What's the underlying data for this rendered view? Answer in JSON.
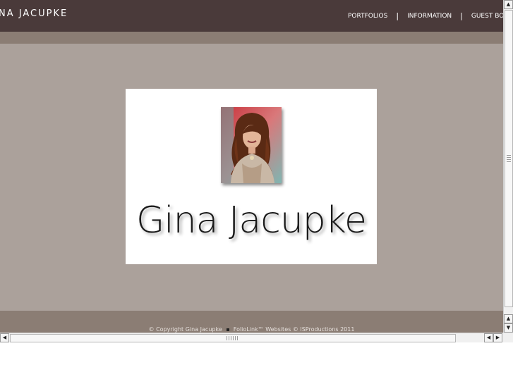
{
  "header": {
    "title": "NA JACUPKE",
    "nav": [
      "PORTFOLIOS",
      "INFORMATION",
      "GUEST BO"
    ],
    "separator": "|"
  },
  "splash": {
    "name": "Gina Jacupke",
    "portrait_icon": "portrait-photo"
  },
  "footer": {
    "copyright": "© Copyright Gina Jacupke",
    "credit": "FolioLink™ Websites © ISProductions 2011"
  },
  "scrollbars": {
    "up": "▲",
    "down": "▼",
    "left": "◀",
    "right": "▶"
  },
  "colors": {
    "topbar": "#4a3a3a",
    "subbar": "#8b7d74",
    "content": "#aba19b",
    "splash": "#ffffff"
  }
}
